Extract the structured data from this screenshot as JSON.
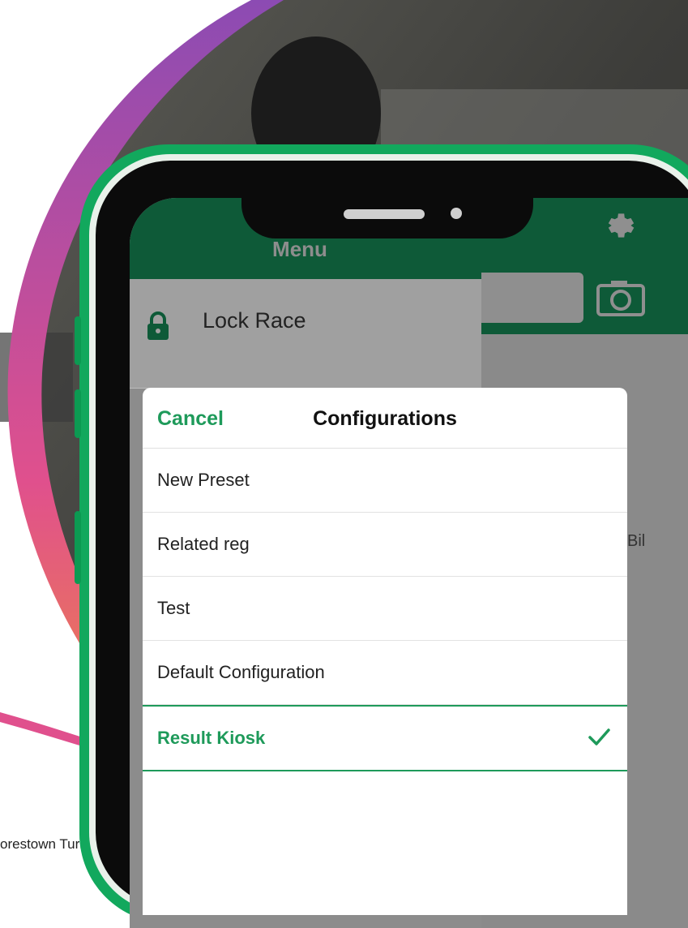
{
  "caption": "orestown Turkey Trot",
  "colors": {
    "accent_green": "#1e9a5a",
    "phone_frame": "#12a85d",
    "app_header": "#0e5a38",
    "arc_gradient_top": "#8c4bb3",
    "arc_gradient_mid": "#e0508d",
    "arc_gradient_bottom": "#f49a2a"
  },
  "menu": {
    "title": "Menu",
    "items": [
      {
        "label": "Lock Race",
        "icon": "lock-icon"
      }
    ]
  },
  "background_app": {
    "partial_text": "Bil",
    "icons": [
      "gear-icon",
      "camera-icon"
    ]
  },
  "configurations_sheet": {
    "cancel_label": "Cancel",
    "title": "Configurations",
    "options": [
      {
        "label": "New Preset",
        "selected": false
      },
      {
        "label": "Related reg",
        "selected": false
      },
      {
        "label": "Test",
        "selected": false
      },
      {
        "label": "Default Configuration",
        "selected": false
      },
      {
        "label": "Result Kiosk",
        "selected": true
      }
    ]
  }
}
